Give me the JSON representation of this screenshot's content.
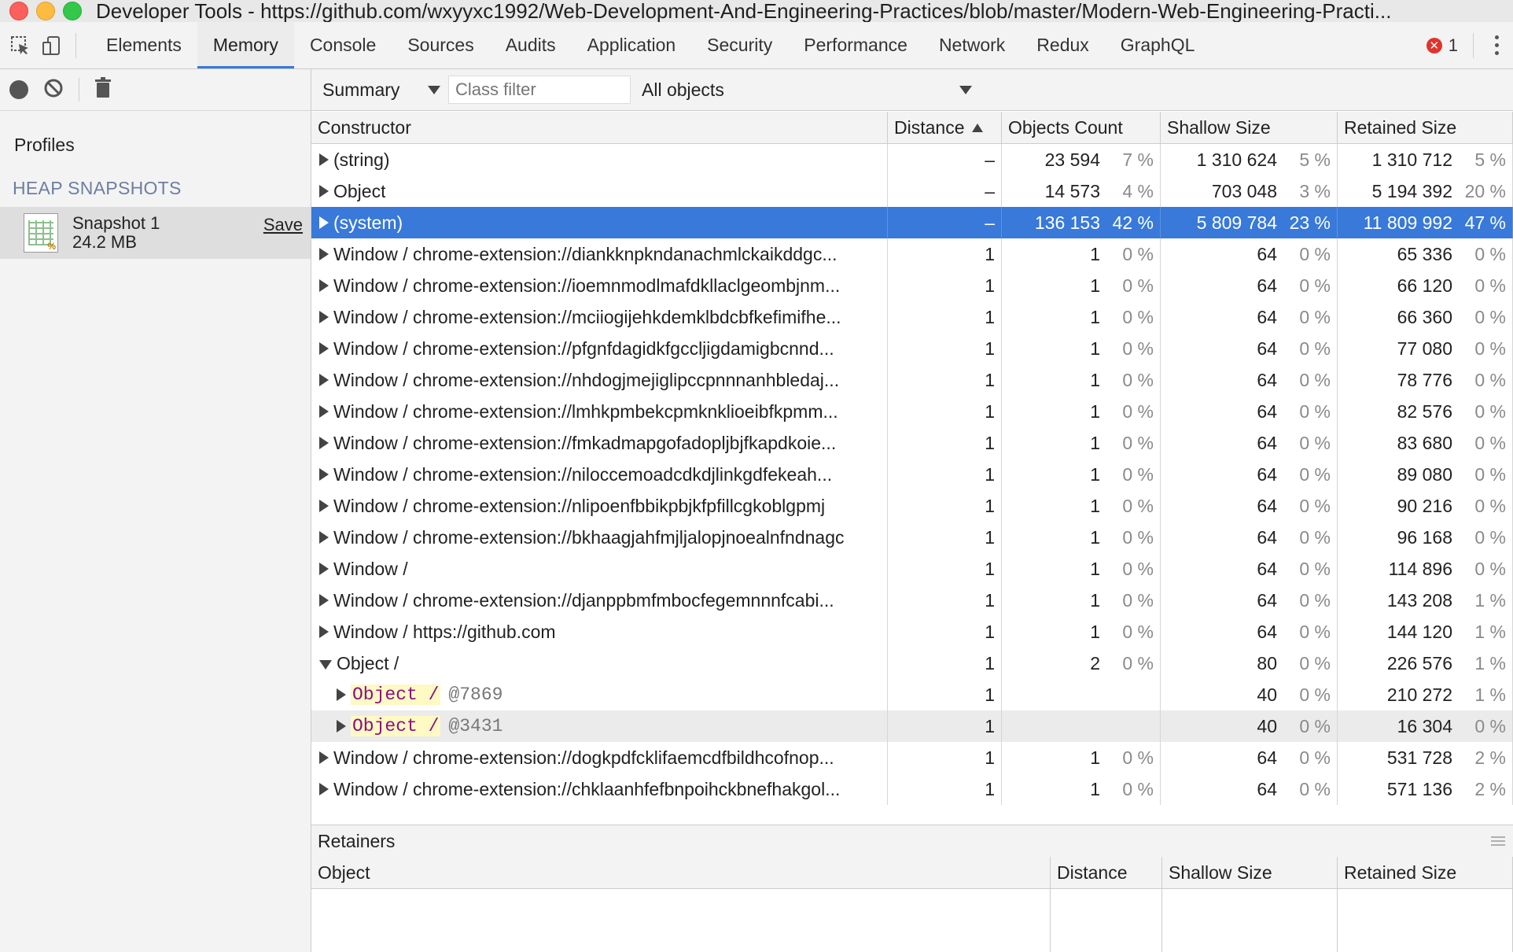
{
  "window": {
    "title": "Developer Tools - https://github.com/wxyyxc1992/Web-Development-And-Engineering-Practices/blob/master/Modern-Web-Engineering-Practi..."
  },
  "toolbar": {
    "tabs": [
      {
        "label": "Elements"
      },
      {
        "label": "Memory"
      },
      {
        "label": "Console"
      },
      {
        "label": "Sources"
      },
      {
        "label": "Audits"
      },
      {
        "label": "Application"
      },
      {
        "label": "Security"
      },
      {
        "label": "Performance"
      },
      {
        "label": "Network"
      },
      {
        "label": "Redux"
      },
      {
        "label": "GraphQL"
      }
    ],
    "active_tab": "Memory",
    "error_count": "1"
  },
  "sidebar": {
    "profiles_label": "Profiles",
    "heap_label": "HEAP SNAPSHOTS",
    "snapshot": {
      "name": "Snapshot 1",
      "size": "24.2 MB",
      "save_label": "Save"
    }
  },
  "filter": {
    "view": "Summary",
    "class_filter_placeholder": "Class filter",
    "objects": "All objects"
  },
  "grid": {
    "headers": {
      "constructor": "Constructor",
      "distance": "Distance",
      "objects_count": "Objects Count",
      "shallow_size": "Shallow Size",
      "retained_size": "Retained Size"
    },
    "rows": [
      {
        "name": "(string)",
        "distance": "–",
        "count": "23 594",
        "count_pct": "7 %",
        "shallow": "1 310 624",
        "shallow_pct": "5 %",
        "retained": "1 310 712",
        "retained_pct": "5 %"
      },
      {
        "name": "Object",
        "distance": "–",
        "count": "14 573",
        "count_pct": "4 %",
        "shallow": "703 048",
        "shallow_pct": "3 %",
        "retained": "5 194 392",
        "retained_pct": "20 %"
      },
      {
        "name": "(system)",
        "distance": "–",
        "count": "136 153",
        "count_pct": "42 %",
        "shallow": "5 809 784",
        "shallow_pct": "23 %",
        "retained": "11 809 992",
        "retained_pct": "47 %",
        "selected": true
      },
      {
        "name": "Window / chrome-extension://diankknpkndanachmlckaikddgc...",
        "distance": "1",
        "count": "1",
        "count_pct": "0 %",
        "shallow": "64",
        "shallow_pct": "0 %",
        "retained": "65 336",
        "retained_pct": "0 %"
      },
      {
        "name": "Window / chrome-extension://ioemnmodlmafdkllaclgeombjnm...",
        "distance": "1",
        "count": "1",
        "count_pct": "0 %",
        "shallow": "64",
        "shallow_pct": "0 %",
        "retained": "66 120",
        "retained_pct": "0 %"
      },
      {
        "name": "Window / chrome-extension://mciiogijehkdemklbdcbfkefimifhe...",
        "distance": "1",
        "count": "1",
        "count_pct": "0 %",
        "shallow": "64",
        "shallow_pct": "0 %",
        "retained": "66 360",
        "retained_pct": "0 %"
      },
      {
        "name": "Window / chrome-extension://pfgnfdagidkfgccljigdamigbcnnd...",
        "distance": "1",
        "count": "1",
        "count_pct": "0 %",
        "shallow": "64",
        "shallow_pct": "0 %",
        "retained": "77 080",
        "retained_pct": "0 %"
      },
      {
        "name": "Window / chrome-extension://nhdogjmejiglipccpnnnanhbledaj...",
        "distance": "1",
        "count": "1",
        "count_pct": "0 %",
        "shallow": "64",
        "shallow_pct": "0 %",
        "retained": "78 776",
        "retained_pct": "0 %"
      },
      {
        "name": "Window / chrome-extension://lmhkpmbekcpmknklioeibfkpmm...",
        "distance": "1",
        "count": "1",
        "count_pct": "0 %",
        "shallow": "64",
        "shallow_pct": "0 %",
        "retained": "82 576",
        "retained_pct": "0 %"
      },
      {
        "name": "Window / chrome-extension://fmkadmapgofadopljbjfkapdkoie...",
        "distance": "1",
        "count": "1",
        "count_pct": "0 %",
        "shallow": "64",
        "shallow_pct": "0 %",
        "retained": "83 680",
        "retained_pct": "0 %"
      },
      {
        "name": "Window / chrome-extension://niloccemoadcdkdjlinkgdfekeah...",
        "distance": "1",
        "count": "1",
        "count_pct": "0 %",
        "shallow": "64",
        "shallow_pct": "0 %",
        "retained": "89 080",
        "retained_pct": "0 %"
      },
      {
        "name": "Window / chrome-extension://nlipoenfbbikpbjkfpfillcgkoblgpmj",
        "distance": "1",
        "count": "1",
        "count_pct": "0 %",
        "shallow": "64",
        "shallow_pct": "0 %",
        "retained": "90 216",
        "retained_pct": "0 %"
      },
      {
        "name": "Window / chrome-extension://bkhaagjahfmjljalopjnoealnfndnagc",
        "distance": "1",
        "count": "1",
        "count_pct": "0 %",
        "shallow": "64",
        "shallow_pct": "0 %",
        "retained": "96 168",
        "retained_pct": "0 %"
      },
      {
        "name": "Window /",
        "distance": "1",
        "count": "1",
        "count_pct": "0 %",
        "shallow": "64",
        "shallow_pct": "0 %",
        "retained": "114 896",
        "retained_pct": "0 %"
      },
      {
        "name": "Window / chrome-extension://djanppbmfmbocfegemnnnfcabi...",
        "distance": "1",
        "count": "1",
        "count_pct": "0 %",
        "shallow": "64",
        "shallow_pct": "0 %",
        "retained": "143 208",
        "retained_pct": "1 %"
      },
      {
        "name": "Window / https://github.com",
        "distance": "1",
        "count": "1",
        "count_pct": "0 %",
        "shallow": "64",
        "shallow_pct": "0 %",
        "retained": "144 120",
        "retained_pct": "1 %"
      },
      {
        "name": "Object /",
        "distance": "1",
        "count": "2",
        "count_pct": "0 %",
        "shallow": "80",
        "shallow_pct": "0 %",
        "retained": "226 576",
        "retained_pct": "1 %",
        "expanded": true
      },
      {
        "name": "Object /",
        "id": "@7869",
        "child": true,
        "distance": "1",
        "count": "",
        "count_pct": "",
        "shallow": "40",
        "shallow_pct": "0 %",
        "retained": "210 272",
        "retained_pct": "1 %"
      },
      {
        "name": "Object /",
        "id": "@3431",
        "child": true,
        "hover": true,
        "distance": "1",
        "count": "",
        "count_pct": "",
        "shallow": "40",
        "shallow_pct": "0 %",
        "retained": "16 304",
        "retained_pct": "0 %"
      },
      {
        "name": "Window / chrome-extension://dogkpdfcklifaemcdfbildhcofnop...",
        "distance": "1",
        "count": "1",
        "count_pct": "0 %",
        "shallow": "64",
        "shallow_pct": "0 %",
        "retained": "531 728",
        "retained_pct": "2 %"
      },
      {
        "name": "Window / chrome-extension://chklaanhfefbnpoihckbnefhakgol...",
        "distance": "1",
        "count": "1",
        "count_pct": "0 %",
        "shallow": "64",
        "shallow_pct": "0 %",
        "retained": "571 136",
        "retained_pct": "2 %"
      }
    ]
  },
  "retainers": {
    "title": "Retainers",
    "headers": {
      "object": "Object",
      "distance": "Distance",
      "shallow_size": "Shallow Size",
      "retained_size": "Retained Size"
    }
  },
  "colors": {
    "selection": "#3879d9",
    "highlight": "#fff9c4"
  }
}
